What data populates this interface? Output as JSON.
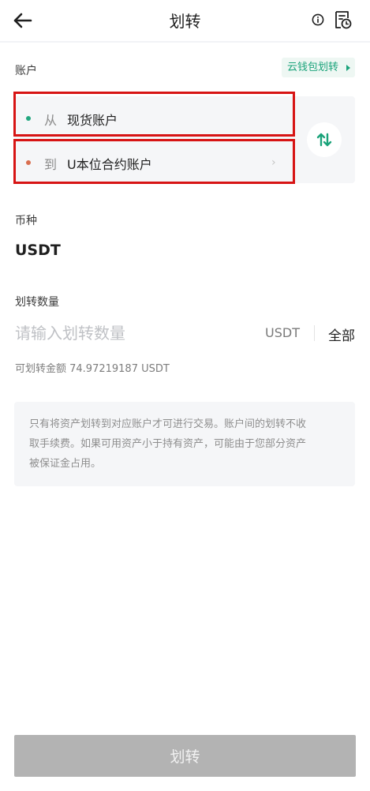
{
  "header": {
    "title": "划转",
    "back_icon": "arrow-left-icon",
    "info_icon": "info-circle-icon",
    "records_icon": "transfer-records-icon"
  },
  "account_section": {
    "label": "账户",
    "cloud_wallet_button": "云钱包划转",
    "from": {
      "prefix": "从",
      "account": "现货账户",
      "dot_color": "#22a77f"
    },
    "to": {
      "prefix": "到",
      "account": "U本位合约账户",
      "dot_color": "#d96e4f",
      "chevron": "›"
    },
    "swap_icon": "swap-arrows-icon"
  },
  "coin_section": {
    "label": "币种",
    "value": "USDT"
  },
  "amount_section": {
    "label": "划转数量",
    "placeholder": "请输入划转数量",
    "unit": "USDT",
    "all_label": "全部",
    "available_text": "可划转金额 74.97219187 USDT"
  },
  "notice": {
    "line1": "只有将资产划转到对应账户才可进行交易。账户间的划转不收",
    "line2": "取手续费。如果可用资产小于持有资产，可能由于您部分资产",
    "line3": "被保证金占用。"
  },
  "submit_button": "划转",
  "colors": {
    "accent_green": "#1aa37a",
    "highlight_red": "#d71414",
    "button_disabled": "#b3b3b3"
  }
}
